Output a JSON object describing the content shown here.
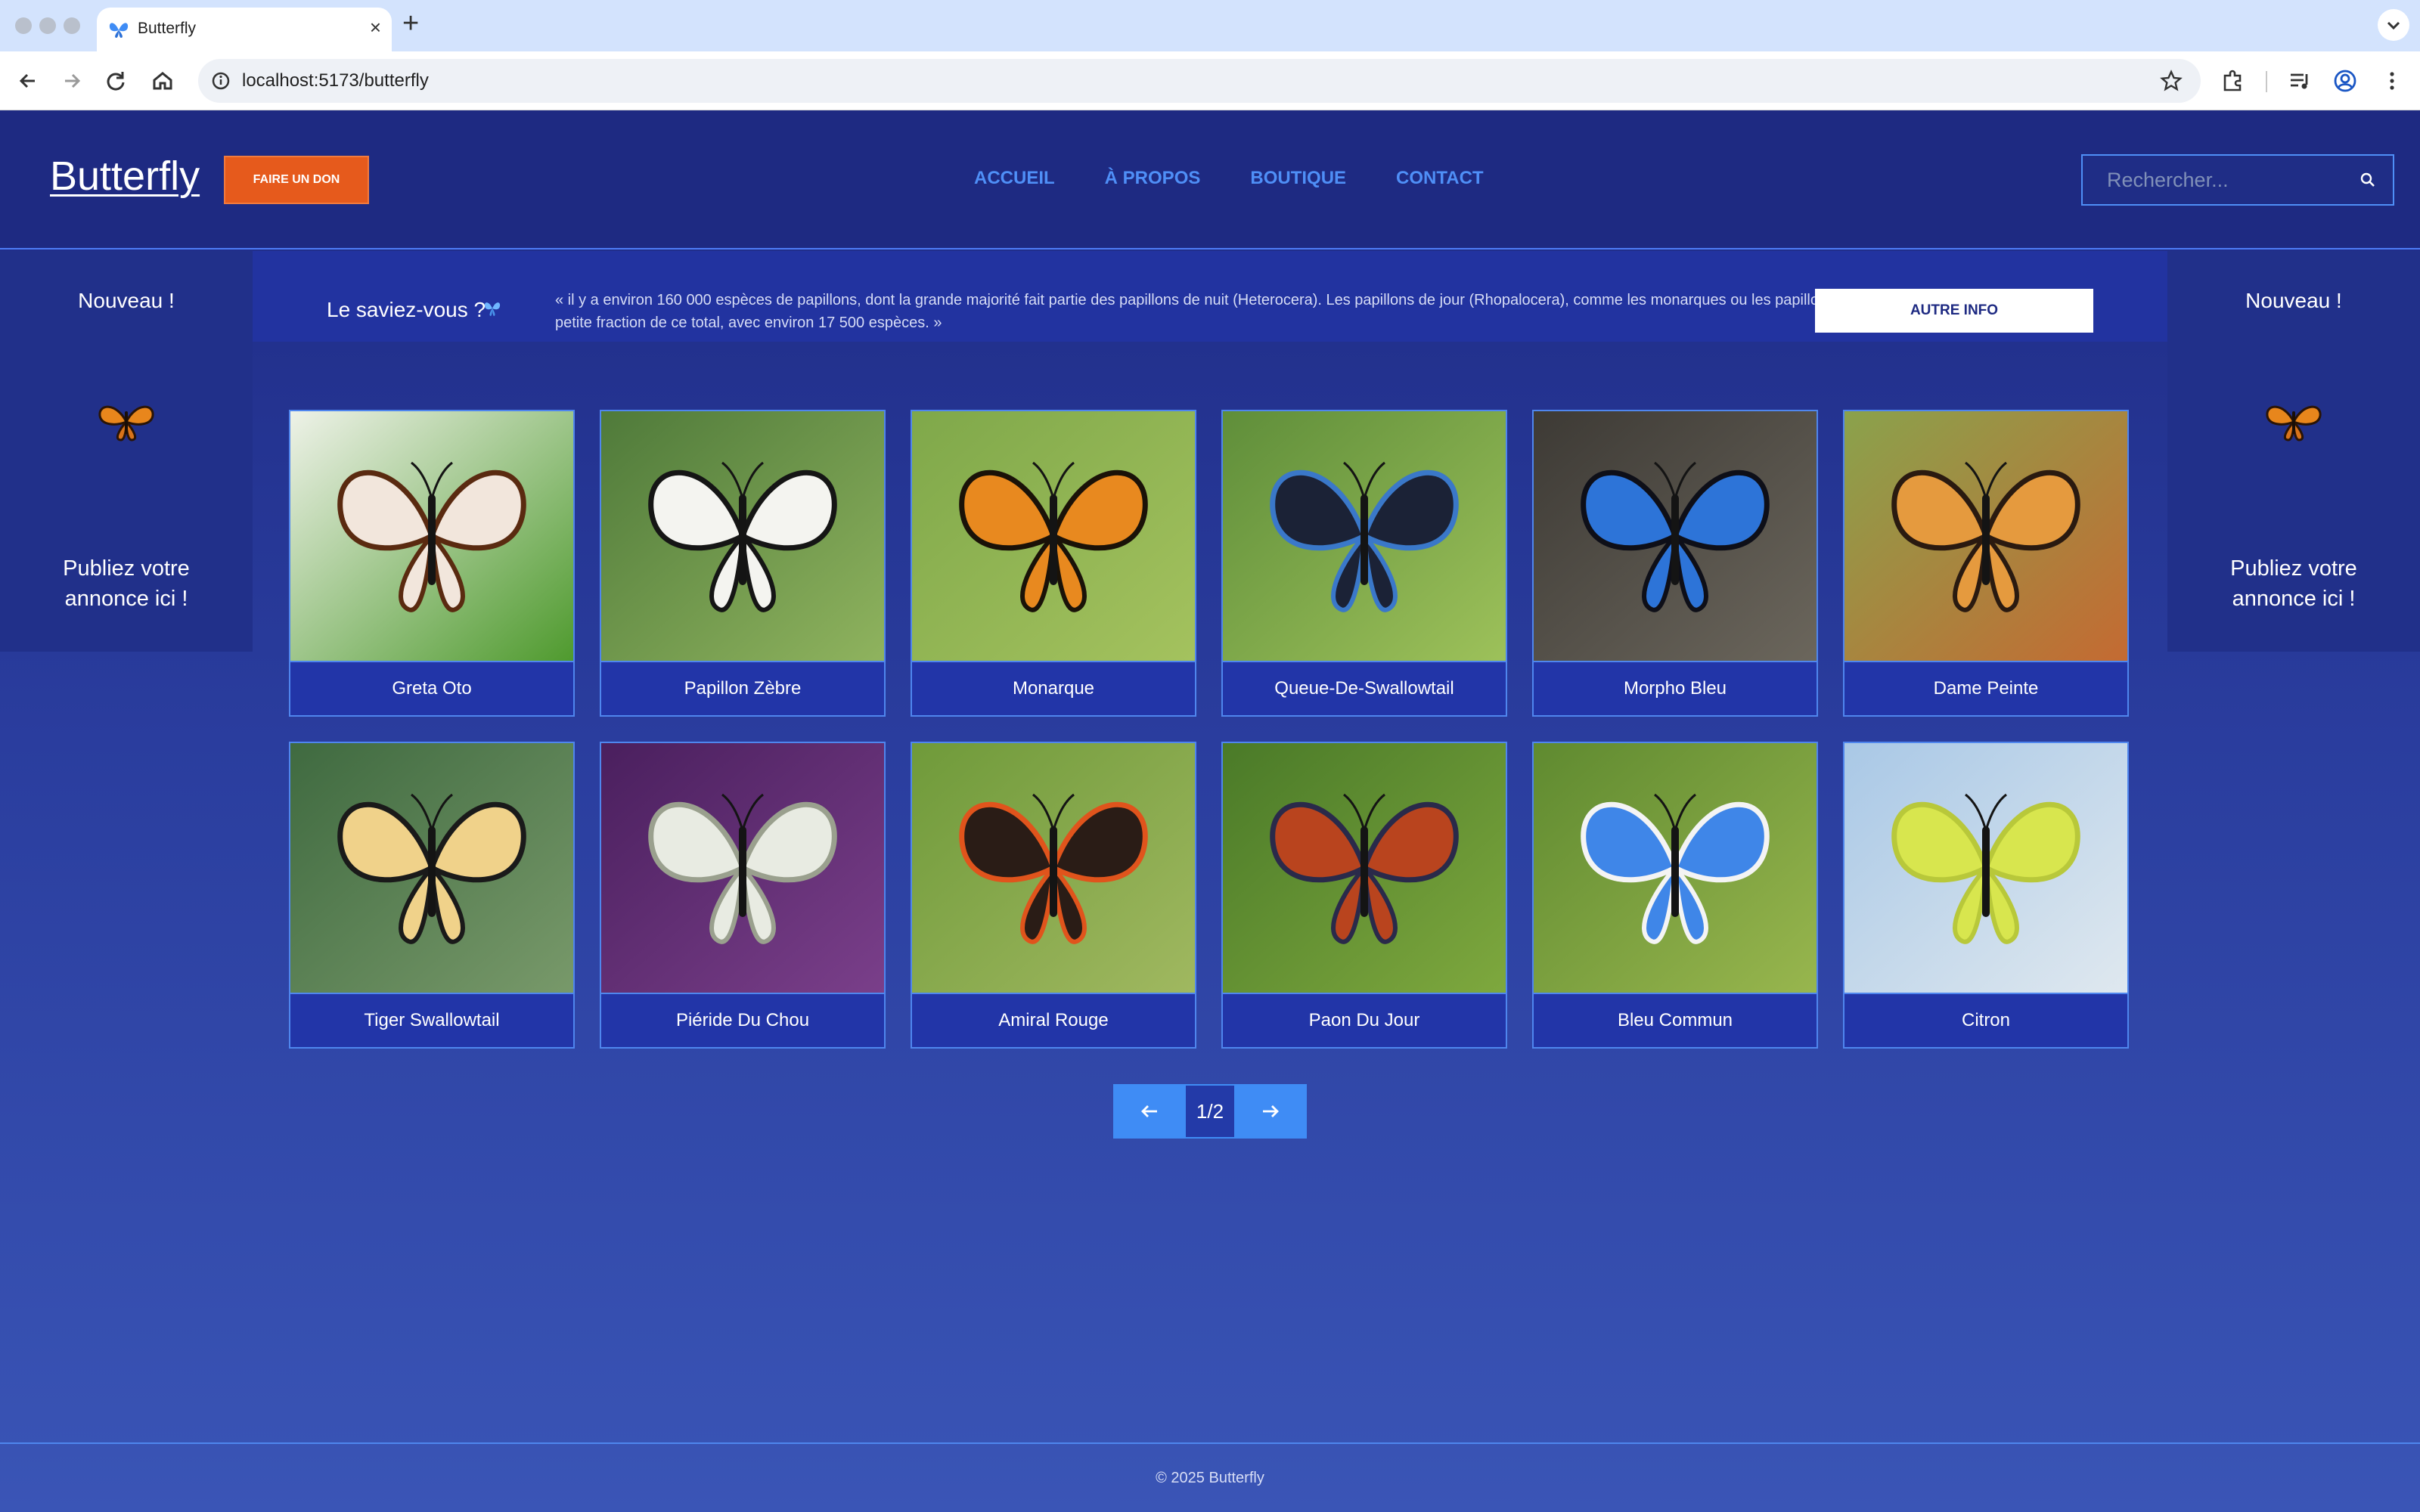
{
  "browser": {
    "tab_title": "Butterfly",
    "tab_close": "×",
    "new_tab": "+",
    "url": "localhost:5173/butterfly"
  },
  "header": {
    "logo": "Butterfly",
    "donate_label": "FAIRE UN DON",
    "nav": [
      "ACCUEIL",
      "À PROPOS",
      "BOUTIQUE",
      "CONTACT"
    ],
    "search_placeholder": "Rechercher..."
  },
  "ads": {
    "left": {
      "title": "Nouveau !",
      "text": "Publiez votre annonce ici !"
    },
    "right": {
      "title": "Nouveau !",
      "text": "Publiez votre annonce ici !"
    }
  },
  "fact": {
    "title": "Le saviez-vous ?",
    "text": "« il y a environ 160 000 espèces de papillons, dont la grande majorité fait partie des papillons de nuit (Heterocera). Les papillons de jour (Rhopalocera), comme les monarques ou les papillons azurés, représentent une petite fraction de ce total, avec environ 17 500 espèces. »",
    "button": "AUTRE INFO"
  },
  "butterflies": [
    {
      "name": "Greta Oto",
      "bg": [
        "#eef2e8",
        "#4f9a2e"
      ],
      "wing": "#f2e6dc",
      "edge": "#5a2a10"
    },
    {
      "name": "Papillon Zèbre",
      "bg": [
        "#4f7a3a",
        "#8fb35e"
      ],
      "wing": "#f4f4f0",
      "edge": "#151515"
    },
    {
      "name": "Monarque",
      "bg": [
        "#7fa84a",
        "#a4c25e"
      ],
      "wing": "#e8891f",
      "edge": "#1a1208"
    },
    {
      "name": "Queue-De-Swallowtail",
      "bg": [
        "#5f8e3a",
        "#9dc15a"
      ],
      "wing": "#1b2236",
      "edge": "#3a78c9"
    },
    {
      "name": "Morpho Bleu",
      "bg": [
        "#3d3a35",
        "#6b665c"
      ],
      "wing": "#2d74d8",
      "edge": "#0e0f18"
    },
    {
      "name": "Dame Peinte",
      "bg": [
        "#8aa24c",
        "#c46a32"
      ],
      "wing": "#e59a3e",
      "edge": "#2a1a10"
    },
    {
      "name": "Tiger Swallowtail",
      "bg": [
        "#3f6a40",
        "#78996a"
      ],
      "wing": "#f0d28a",
      "edge": "#1a1a1a"
    },
    {
      "name": "Piéride Du Chou",
      "bg": [
        "#4a1f5e",
        "#7a3f8a"
      ],
      "wing": "#e8ebe2",
      "edge": "#9aa08e"
    },
    {
      "name": "Amiral Rouge",
      "bg": [
        "#6f9a3a",
        "#a0b860"
      ],
      "wing": "#2a1c16",
      "edge": "#e0541c"
    },
    {
      "name": "Paon Du Jour",
      "bg": [
        "#4a7a28",
        "#7ea83e"
      ],
      "wing": "#b9441e",
      "edge": "#2a2a4a"
    },
    {
      "name": "Bleu Commun",
      "bg": [
        "#5f8a30",
        "#98b64e"
      ],
      "wing": "#3f86e8",
      "edge": "#f4f4f4"
    },
    {
      "name": "Citron",
      "bg": [
        "#a9c8e6",
        "#dfe8ef"
      ],
      "wing": "#d8e64e",
      "edge": "#b8c83a"
    }
  ],
  "pagination": {
    "page": "1/2"
  },
  "footer": {
    "text": "© 2025 Butterfly"
  },
  "colors": {
    "page_bg": "#1f2d86",
    "accent_blue": "#4f8ff7",
    "donate_orange": "#e65a1c",
    "card_border": "#4f86ee"
  }
}
